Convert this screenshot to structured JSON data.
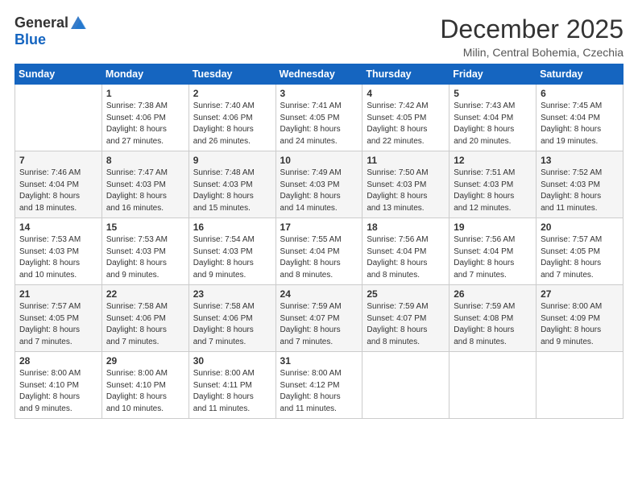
{
  "logo": {
    "general": "General",
    "blue": "Blue"
  },
  "header": {
    "month_title": "December 2025",
    "location": "Milin, Central Bohemia, Czechia"
  },
  "weekdays": [
    "Sunday",
    "Monday",
    "Tuesday",
    "Wednesday",
    "Thursday",
    "Friday",
    "Saturday"
  ],
  "weeks": [
    [
      {
        "day": "",
        "info": ""
      },
      {
        "day": "1",
        "info": "Sunrise: 7:38 AM\nSunset: 4:06 PM\nDaylight: 8 hours\nand 27 minutes."
      },
      {
        "day": "2",
        "info": "Sunrise: 7:40 AM\nSunset: 4:06 PM\nDaylight: 8 hours\nand 26 minutes."
      },
      {
        "day": "3",
        "info": "Sunrise: 7:41 AM\nSunset: 4:05 PM\nDaylight: 8 hours\nand 24 minutes."
      },
      {
        "day": "4",
        "info": "Sunrise: 7:42 AM\nSunset: 4:05 PM\nDaylight: 8 hours\nand 22 minutes."
      },
      {
        "day": "5",
        "info": "Sunrise: 7:43 AM\nSunset: 4:04 PM\nDaylight: 8 hours\nand 20 minutes."
      },
      {
        "day": "6",
        "info": "Sunrise: 7:45 AM\nSunset: 4:04 PM\nDaylight: 8 hours\nand 19 minutes."
      }
    ],
    [
      {
        "day": "7",
        "info": "Sunrise: 7:46 AM\nSunset: 4:04 PM\nDaylight: 8 hours\nand 18 minutes."
      },
      {
        "day": "8",
        "info": "Sunrise: 7:47 AM\nSunset: 4:03 PM\nDaylight: 8 hours\nand 16 minutes."
      },
      {
        "day": "9",
        "info": "Sunrise: 7:48 AM\nSunset: 4:03 PM\nDaylight: 8 hours\nand 15 minutes."
      },
      {
        "day": "10",
        "info": "Sunrise: 7:49 AM\nSunset: 4:03 PM\nDaylight: 8 hours\nand 14 minutes."
      },
      {
        "day": "11",
        "info": "Sunrise: 7:50 AM\nSunset: 4:03 PM\nDaylight: 8 hours\nand 13 minutes."
      },
      {
        "day": "12",
        "info": "Sunrise: 7:51 AM\nSunset: 4:03 PM\nDaylight: 8 hours\nand 12 minutes."
      },
      {
        "day": "13",
        "info": "Sunrise: 7:52 AM\nSunset: 4:03 PM\nDaylight: 8 hours\nand 11 minutes."
      }
    ],
    [
      {
        "day": "14",
        "info": "Sunrise: 7:53 AM\nSunset: 4:03 PM\nDaylight: 8 hours\nand 10 minutes."
      },
      {
        "day": "15",
        "info": "Sunrise: 7:53 AM\nSunset: 4:03 PM\nDaylight: 8 hours\nand 9 minutes."
      },
      {
        "day": "16",
        "info": "Sunrise: 7:54 AM\nSunset: 4:03 PM\nDaylight: 8 hours\nand 9 minutes."
      },
      {
        "day": "17",
        "info": "Sunrise: 7:55 AM\nSunset: 4:04 PM\nDaylight: 8 hours\nand 8 minutes."
      },
      {
        "day": "18",
        "info": "Sunrise: 7:56 AM\nSunset: 4:04 PM\nDaylight: 8 hours\nand 8 minutes."
      },
      {
        "day": "19",
        "info": "Sunrise: 7:56 AM\nSunset: 4:04 PM\nDaylight: 8 hours\nand 7 minutes."
      },
      {
        "day": "20",
        "info": "Sunrise: 7:57 AM\nSunset: 4:05 PM\nDaylight: 8 hours\nand 7 minutes."
      }
    ],
    [
      {
        "day": "21",
        "info": "Sunrise: 7:57 AM\nSunset: 4:05 PM\nDaylight: 8 hours\nand 7 minutes."
      },
      {
        "day": "22",
        "info": "Sunrise: 7:58 AM\nSunset: 4:06 PM\nDaylight: 8 hours\nand 7 minutes."
      },
      {
        "day": "23",
        "info": "Sunrise: 7:58 AM\nSunset: 4:06 PM\nDaylight: 8 hours\nand 7 minutes."
      },
      {
        "day": "24",
        "info": "Sunrise: 7:59 AM\nSunset: 4:07 PM\nDaylight: 8 hours\nand 7 minutes."
      },
      {
        "day": "25",
        "info": "Sunrise: 7:59 AM\nSunset: 4:07 PM\nDaylight: 8 hours\nand 8 minutes."
      },
      {
        "day": "26",
        "info": "Sunrise: 7:59 AM\nSunset: 4:08 PM\nDaylight: 8 hours\nand 8 minutes."
      },
      {
        "day": "27",
        "info": "Sunrise: 8:00 AM\nSunset: 4:09 PM\nDaylight: 8 hours\nand 9 minutes."
      }
    ],
    [
      {
        "day": "28",
        "info": "Sunrise: 8:00 AM\nSunset: 4:10 PM\nDaylight: 8 hours\nand 9 minutes."
      },
      {
        "day": "29",
        "info": "Sunrise: 8:00 AM\nSunset: 4:10 PM\nDaylight: 8 hours\nand 10 minutes."
      },
      {
        "day": "30",
        "info": "Sunrise: 8:00 AM\nSunset: 4:11 PM\nDaylight: 8 hours\nand 11 minutes."
      },
      {
        "day": "31",
        "info": "Sunrise: 8:00 AM\nSunset: 4:12 PM\nDaylight: 8 hours\nand 11 minutes."
      },
      {
        "day": "",
        "info": ""
      },
      {
        "day": "",
        "info": ""
      },
      {
        "day": "",
        "info": ""
      }
    ]
  ]
}
